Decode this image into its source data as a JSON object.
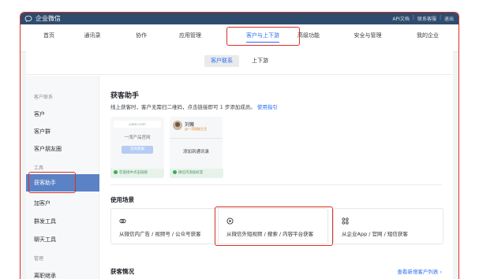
{
  "app": {
    "title": "企业微信"
  },
  "toplinks": {
    "api": "API文档",
    "sep1": "|",
    "service": "联系客服",
    "sep2": "|",
    "logout": "退出"
  },
  "nav": {
    "items": [
      "首页",
      "通讯录",
      "协作",
      "应用管理",
      "客户与上下游",
      "高级功能",
      "安全与管理",
      "我的企业"
    ],
    "active_index": 4
  },
  "subtabs": {
    "customer": "客户联系",
    "upstream": "上下游",
    "active": "客户联系"
  },
  "sidebar": {
    "group1": "客户联系",
    "customer": "客户",
    "customer_group": "客户群",
    "moments": "客户朋友圈",
    "group2": "工具",
    "active": "获客助手",
    "add_friend": "加客户",
    "mass": "群发工具",
    "chat": "聊天工具",
    "group3": "管理",
    "resign": "离职继承"
  },
  "main": {
    "title": "获客助手",
    "desc": "线上获客时，客户无需扫二维码，点击链接即可 1 步添加成员。",
    "desc_link": "使用指引",
    "demo": {
      "url": "yiwan.com",
      "site_text": "一湾产品官网",
      "site_btn": "咨询客服",
      "green_note": "在链接中点击链接",
      "contact_name": "刘薇",
      "contact_tag": "@一湾智能生活",
      "add_contact": "添加到通讯录",
      "green_note2": "微信内添加好友"
    },
    "scenes_title": "使用场景",
    "scenes": [
      {
        "icon": "link-icon",
        "label": "从微信内广告 / 视频号 / 公众号获客"
      },
      {
        "icon": "douyin-icon",
        "label": "从微信外短视频 / 搜索 / 内容平台获客"
      },
      {
        "icon": "apps-icon",
        "label": "从企业App / 官网 / 短信获客"
      }
    ],
    "stats_title": "获客情况",
    "stats_link": "查看新增客户列表 ›"
  },
  "colors": {
    "accent": "#2a6df4",
    "highlight": "#d93025",
    "topbar": "#2f4b6e",
    "sidebar_active": "#5a82c5"
  }
}
